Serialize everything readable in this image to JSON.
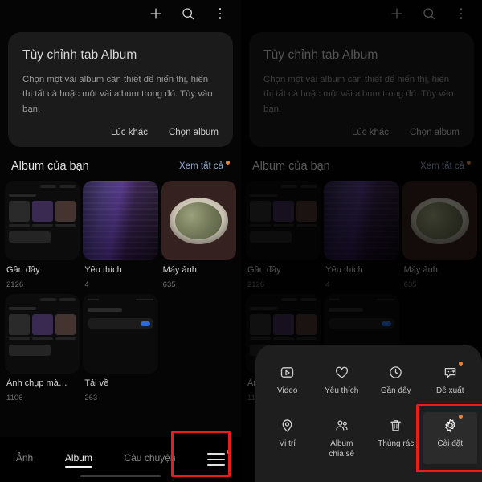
{
  "app": {
    "topbar": {
      "add_icon": "plus-icon",
      "search_icon": "search-icon",
      "more_icon": "overflow-menu-icon"
    },
    "tip_card": {
      "title": "Tùy chỉnh tab Album",
      "body": "Chọn một vài album cần thiết để hiển thị, hiển thị tất cả hoặc một vài album trong đó. Tùy vào bạn.",
      "dismiss_label": "Lúc khác",
      "confirm_label": "Chọn album"
    },
    "section": {
      "title": "Album của bạn",
      "see_all_label": "Xem tất cả",
      "see_all_has_badge": true
    },
    "albums": [
      {
        "name": "Gần đây",
        "count": "2126",
        "thumb": "screenshot",
        "badge": false
      },
      {
        "name": "Yêu thích",
        "count": "4",
        "thumb": "poster",
        "badge": false
      },
      {
        "name": "Máy ảnh",
        "count": "635",
        "thumb": "food",
        "badge": false
      },
      {
        "name": "Ảnh chụp mà…",
        "count": "1106",
        "thumb": "screenshot",
        "badge": true
      },
      {
        "name": "Tải về",
        "count": "263",
        "thumb": "settings",
        "badge": false
      }
    ],
    "tabs": [
      {
        "label": "Ảnh",
        "active": false
      },
      {
        "label": "Album",
        "active": true
      },
      {
        "label": "Câu chuyện",
        "active": false
      }
    ],
    "menu_button": {
      "icon": "hamburger-menu-icon",
      "has_badge": true,
      "highlighted": true
    },
    "sheet": {
      "items": [
        {
          "label": "Video",
          "icon": "video-icon",
          "badge": false,
          "selected": false
        },
        {
          "label": "Yêu thích",
          "icon": "heart-icon",
          "badge": false,
          "selected": false
        },
        {
          "label": "Gần đây",
          "icon": "clock-icon",
          "badge": false,
          "selected": false
        },
        {
          "label": "Đề xuất",
          "icon": "suggest-icon",
          "badge": true,
          "selected": false
        },
        {
          "label": "Vị trí",
          "icon": "location-icon",
          "badge": false,
          "selected": false
        },
        {
          "label": "Album\nchia sẻ",
          "icon": "people-icon",
          "badge": false,
          "selected": false
        },
        {
          "label": "Thùng rác",
          "icon": "trash-icon",
          "badge": false,
          "selected": false
        },
        {
          "label": "Cài đặt",
          "icon": "gear-icon",
          "badge": true,
          "selected": true
        }
      ]
    },
    "colors": {
      "background": "#000000",
      "card": "#1b1b1b",
      "sheet": "#1e1e1e",
      "link": "#8fa7c9",
      "badge": "#e8833a",
      "highlight": "#ee1b1b",
      "text_primary": "#e3e3e3",
      "text_secondary": "#9b9b9b"
    }
  }
}
